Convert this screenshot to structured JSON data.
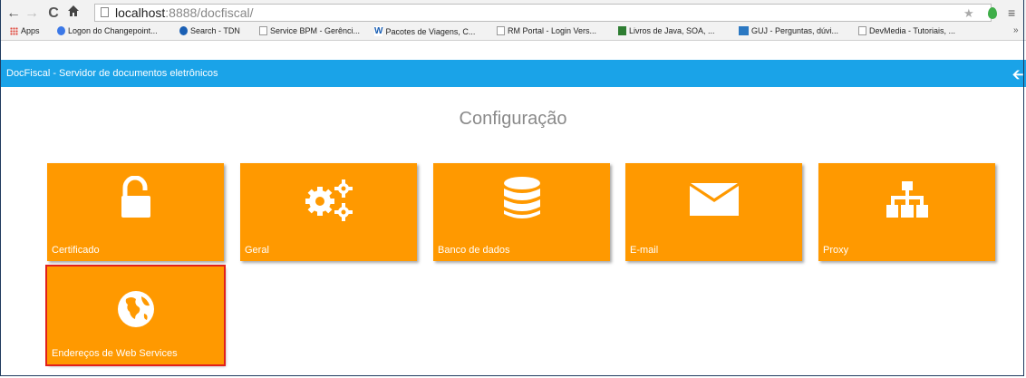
{
  "browser": {
    "url_host": "localhost",
    "url_rest": ":8888/docfiscal/",
    "bookmarks": [
      {
        "label": "Apps",
        "icon": "apps-icon"
      },
      {
        "label": "Logon do Changepoint...",
        "icon": "google-icon"
      },
      {
        "label": "Search - TDN",
        "icon": "search-site-icon"
      },
      {
        "label": "Service BPM - Gerênci...",
        "icon": "page-icon"
      },
      {
        "label": "Pacotes de Viagens, C...",
        "icon": "travel-logo-icon"
      },
      {
        "label": "RM Portal - Login Vers...",
        "icon": "page-icon"
      },
      {
        "label": "Livros de Java, SOA, ...",
        "icon": "book-logo-icon"
      },
      {
        "label": "GUJ - Perguntas, dúvi...",
        "icon": "guj-logo-icon"
      },
      {
        "label": "DevMedia - Tutoriais, ...",
        "icon": "page-icon"
      }
    ],
    "more": "»"
  },
  "appbar": {
    "title": "DocFiscal - Servidor de documentos eletrônicos",
    "back_icon": "arrow-left-icon"
  },
  "page": {
    "title": "Configuração"
  },
  "tiles": [
    {
      "label": "Certificado",
      "icon": "unlock-icon"
    },
    {
      "label": "Geral",
      "icon": "gears-icon"
    },
    {
      "label": "Banco de dados",
      "icon": "database-icon"
    },
    {
      "label": "E-mail",
      "icon": "envelope-icon"
    },
    {
      "label": "Proxy",
      "icon": "sitemap-icon"
    },
    {
      "label": "Endereços de Web Services",
      "icon": "globe-icon",
      "selected": true
    }
  ],
  "colors": {
    "appbar": "#1aa3e8",
    "tile": "#ff9900",
    "selected_outline": "#e1201b"
  }
}
